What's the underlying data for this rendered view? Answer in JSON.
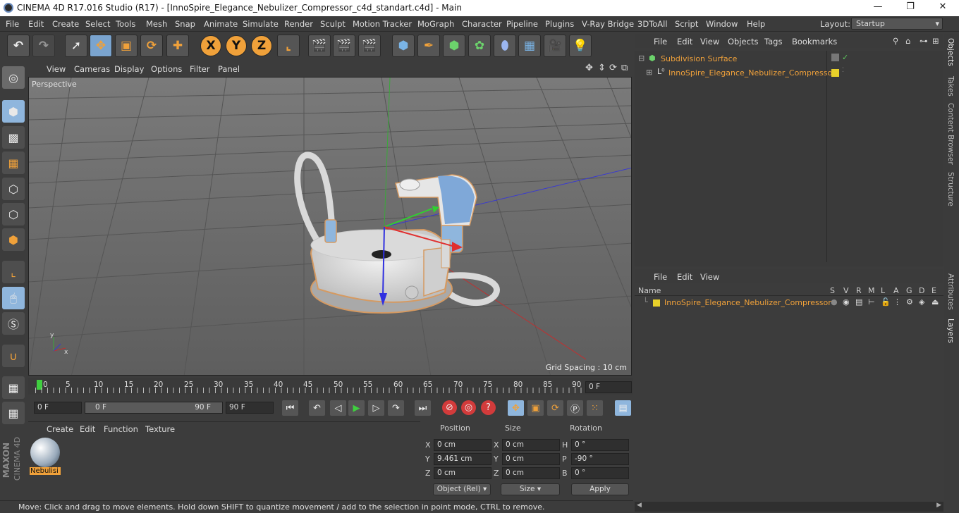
{
  "window": {
    "title": "CINEMA 4D R17.016 Studio (R17) - [InnoSpire_Elegance_Nebulizer_Compressor_c4d_standart.c4d] - Main",
    "min": "—",
    "max": "❐",
    "close": "✕"
  },
  "menu": [
    "File",
    "Edit",
    "Create",
    "Select",
    "Tools",
    "Mesh",
    "Snap",
    "Animate",
    "Simulate",
    "Render",
    "Sculpt",
    "Motion Tracker",
    "MoGraph",
    "Character",
    "Pipeline",
    "Plugins",
    "V-Ray Bridge",
    "3DToAll",
    "Script",
    "Window",
    "Help"
  ],
  "layout": {
    "label": "Layout:",
    "value": "Startup"
  },
  "viewport": {
    "menu": [
      "View",
      "Cameras",
      "Display",
      "Options",
      "Filter",
      "Panel"
    ],
    "label": "Perspective",
    "grid_spacing": "Grid Spacing : 10 cm"
  },
  "timeline": {
    "ticks": [
      "0",
      "5",
      "10",
      "15",
      "20",
      "25",
      "30",
      "35",
      "40",
      "45",
      "50",
      "55",
      "60",
      "65",
      "70",
      "75",
      "80",
      "85",
      "90"
    ],
    "current": "0 F",
    "start": "0 F",
    "range_start": "0 F",
    "range_end": "90 F",
    "end": "90 F"
  },
  "material": {
    "menu": [
      "Create",
      "Edit",
      "Function",
      "Texture"
    ],
    "item": "Nebulisi"
  },
  "coordinates": {
    "headers": {
      "position": "Position",
      "size": "Size",
      "rotation": "Rotation"
    },
    "rows": [
      {
        "axis": "X",
        "pos": "0 cm",
        "size_axis": "X",
        "size": "0 cm",
        "rot_axis": "H",
        "rot": "0 °"
      },
      {
        "axis": "Y",
        "pos": "9.461 cm",
        "size_axis": "Y",
        "size": "0 cm",
        "rot_axis": "P",
        "rot": "-90 °"
      },
      {
        "axis": "Z",
        "pos": "0 cm",
        "size_axis": "Z",
        "size": "0 cm",
        "rot_axis": "B",
        "rot": "0 °"
      }
    ],
    "mode": "Object (Rel)",
    "size_mode": "Size",
    "apply": "Apply"
  },
  "objects": {
    "menu": [
      "File",
      "Edit",
      "View",
      "Objects",
      "Tags",
      "Bookmarks"
    ],
    "items": [
      {
        "name": "Subdivision Surface"
      },
      {
        "name": "InnoSpire_Elegance_Nebulizer_Compressor"
      }
    ]
  },
  "layers": {
    "menu": [
      "File",
      "Edit",
      "View"
    ],
    "columns": [
      "Name",
      "S",
      "V",
      "R",
      "M",
      "L",
      "A",
      "G",
      "D",
      "E"
    ],
    "items": [
      {
        "name": "InnoSpire_Elegance_Nebulizer_Compressor"
      }
    ]
  },
  "side_tabs": [
    "Objects",
    "Takes",
    "Content Browser",
    "Structure",
    "Attributes",
    "Layers"
  ],
  "status": "Move: Click and drag to move elements. Hold down SHIFT to quantize movement / add to the selection in point mode, CTRL to remove.",
  "brand": {
    "line1": "MAXON",
    "line2": "CINEMA 4D"
  },
  "colors": {
    "accent": "#f0a13a",
    "selected": "#8fb6dd",
    "layer": "#e8d12a"
  }
}
